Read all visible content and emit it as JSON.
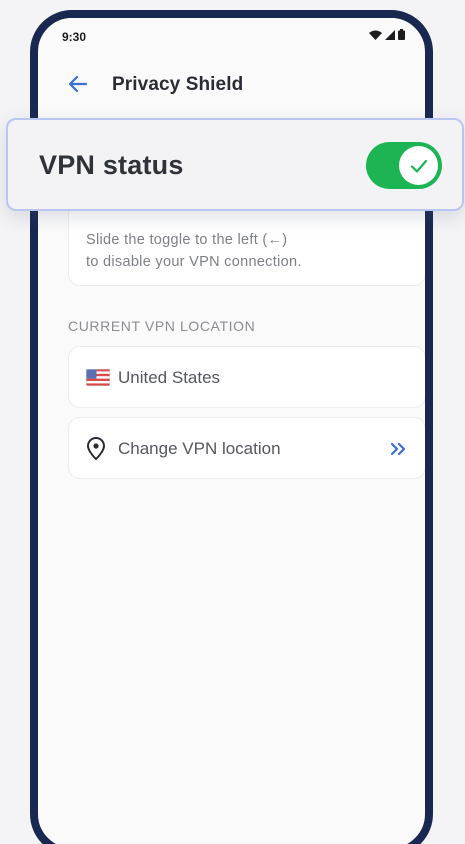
{
  "status_bar": {
    "time": "9:30",
    "icons": [
      "wifi-icon",
      "signal-icon",
      "battery-icon"
    ]
  },
  "app_bar": {
    "back_icon": "arrow-left-icon",
    "title": "Privacy Shield"
  },
  "vpn_status": {
    "label": "VPN status",
    "toggle_on": true,
    "toggle_icon": "check-icon"
  },
  "info_card": {
    "line1": "Slide the toggle to the left (←)",
    "line2": "to disable your VPN connection."
  },
  "location_section": {
    "label": "CURRENT VPN LOCATION",
    "current_location": "United States",
    "flag_icon": "us-flag-icon",
    "change_label": "Change VPN location",
    "change_icon": "location-pin-icon",
    "action_icon": "double-chevron-right-icon"
  },
  "colors": {
    "accent": "#3b6fd6",
    "toggle_on": "#1db453",
    "frame": "#182850"
  }
}
